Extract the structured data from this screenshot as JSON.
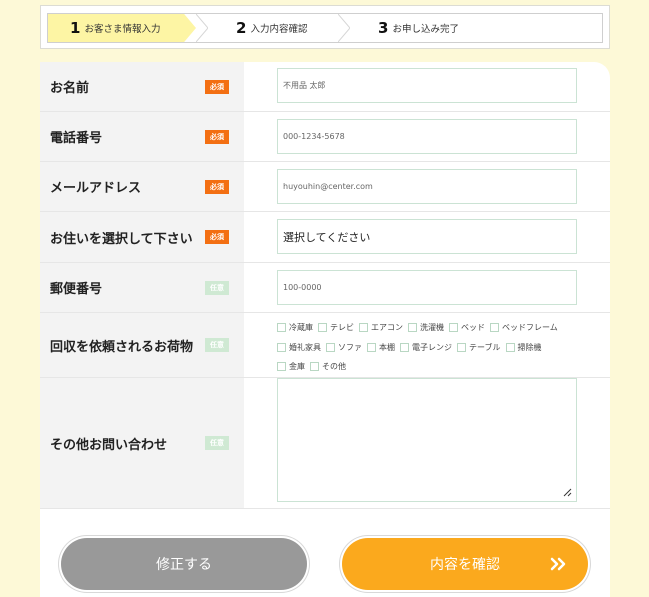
{
  "steps": [
    {
      "num": "1",
      "label": "お客さま情報入力"
    },
    {
      "num": "2",
      "label": "入力内容確認"
    },
    {
      "num": "3",
      "label": "お申し込み完了"
    }
  ],
  "fields": {
    "name": {
      "label": "お名前",
      "badge": "必須",
      "placeholder": "不用品 太郎"
    },
    "phone": {
      "label": "電話番号",
      "badge": "必須",
      "placeholder": "000-1234-5678"
    },
    "email": {
      "label": "メールアドレス",
      "badge": "必須",
      "placeholder": "huyouhin@center.com"
    },
    "address": {
      "label": "お住いを選択して下さい",
      "badge": "必須",
      "value": "選択してください"
    },
    "postal": {
      "label": "郵便番号",
      "badge": "任意",
      "placeholder": "100-0000"
    },
    "items": {
      "label": "回収を依頼されるお荷物",
      "badge": "任意",
      "options": [
        [
          "冷蔵庫",
          "テレビ",
          "エアコン",
          "洗濯機",
          "ベッド",
          "ベッドフレーム"
        ],
        [
          "婚礼家具",
          "ソファ",
          "本棚",
          "電子レンジ",
          "テーブル",
          "掃除機"
        ],
        [
          "金庫",
          "その他"
        ]
      ]
    },
    "other": {
      "label": "その他お問い合わせ",
      "badge": "任意"
    }
  },
  "buttons": {
    "fix": "修正する",
    "confirm": "内容を確認"
  },
  "colors": {
    "required": "#f36f12",
    "optional": "#cfe9d3",
    "confirm": "#fba91d",
    "fix": "#999999",
    "step_active": "#fdf5a4"
  }
}
